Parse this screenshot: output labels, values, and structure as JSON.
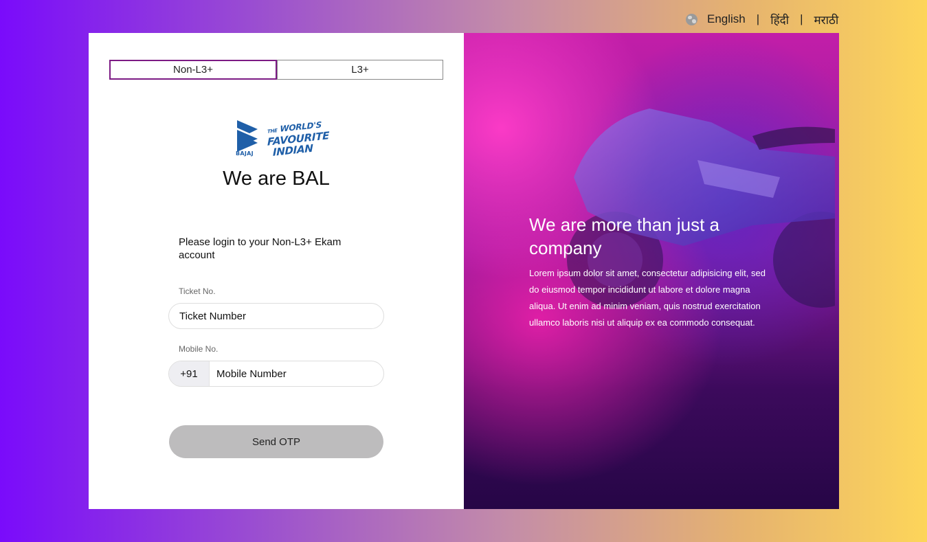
{
  "languages": [
    {
      "label": "English"
    },
    {
      "label": "हिंदी"
    },
    {
      "label": "मराठी"
    }
  ],
  "language_separator": "|",
  "tabs": [
    {
      "label": "Non-L3+",
      "active": true
    },
    {
      "label": "L3+",
      "active": false
    }
  ],
  "logo": {
    "brand": "BAJAJ",
    "tagline_small": "THE",
    "tagline_line1": "WORLD'S",
    "tagline_line2": "FAVOURITE",
    "tagline_line3": "INDIAN",
    "brand_color": "#1f5fa8"
  },
  "headline": "We are BAL",
  "intro": "Please login to your Non-L3+ Ekam account",
  "form": {
    "ticket_label": "Ticket No.",
    "ticket_placeholder": "Ticket Number",
    "mobile_label": "Mobile No.",
    "mobile_prefix": "+91",
    "mobile_placeholder": "Mobile Number",
    "submit_label": "Send OTP"
  },
  "hero": {
    "title": "We are more than just a company",
    "body": "Lorem ipsum dolor sit amet, consectetur adipisicing elit, sed do eiusmod tempor incididunt ut labore et dolore magna aliqua. Ut enim ad minim veniam, quis nostrud exercitation ullamco laboris nisi ut aliquip ex ea commodo consequat."
  },
  "colors": {
    "active_tab_border": "#7c1a84",
    "button_bg": "#bdbcbd"
  }
}
